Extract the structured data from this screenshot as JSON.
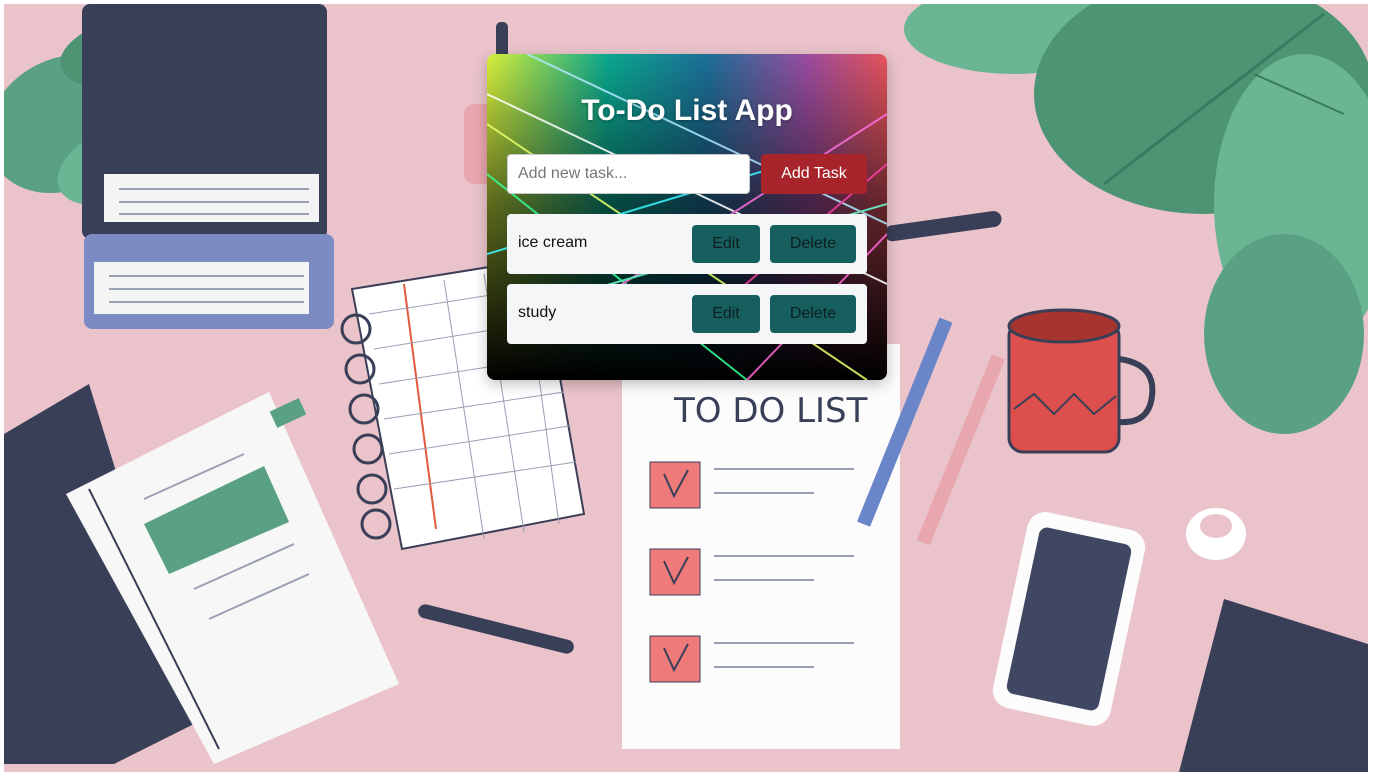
{
  "app": {
    "title": "To-Do List App"
  },
  "input": {
    "placeholder": "Add new task...",
    "value": ""
  },
  "add_button": {
    "label": "Add Task"
  },
  "tasks": [
    {
      "text": "ice cream",
      "edit_label": "Edit",
      "delete_label": "Delete"
    },
    {
      "text": "study",
      "edit_label": "Edit",
      "delete_label": "Delete"
    }
  ],
  "background": {
    "poster_title": "TO DO LIST"
  },
  "colors": {
    "page_bg": "#ebc4cb",
    "add_button": "#a6242a",
    "task_button": "#175e5f",
    "task_item_bg": "#f5f6f7",
    "title_text": "#ffffff"
  }
}
